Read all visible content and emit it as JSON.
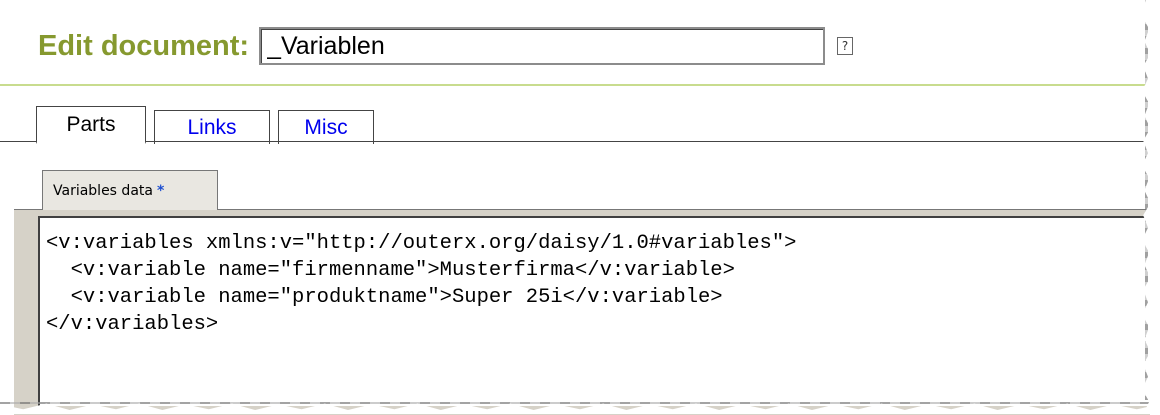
{
  "header": {
    "title": "Edit document:",
    "document_name": "_Variablen",
    "help_label": "?"
  },
  "tabs": [
    {
      "label": "Parts",
      "active": true
    },
    {
      "label": "Links",
      "active": false
    },
    {
      "label": "Misc",
      "active": false
    }
  ],
  "part": {
    "label": "Variables data",
    "modified_marker": "*"
  },
  "editor": {
    "lines": [
      "<v:variables xmlns:v=\"http://outerx.org/daisy/1.0#variables\">",
      "  <v:variable name=\"firmenname\">Musterfirma</v:variable>",
      "  <v:variable name=\"produktname\">Super 25i</v:variable>",
      "</v:variables>"
    ]
  },
  "colors": {
    "title": "#86992f",
    "link": "#0000ee",
    "separator": "#c8dc8e",
    "part_tab_bg": "#e9e7e1",
    "frame_bg": "#d6d2c8"
  }
}
